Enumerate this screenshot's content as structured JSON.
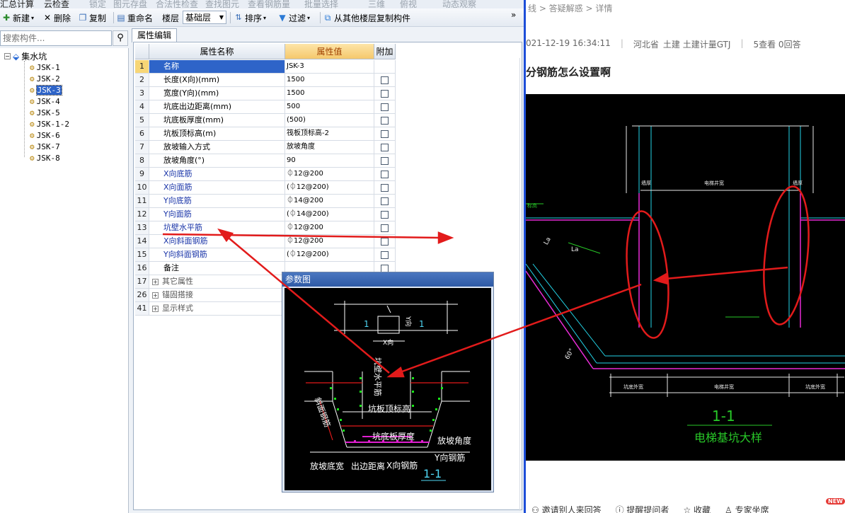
{
  "menubar": {
    "items": [
      "汇总计算",
      "云检查",
      "锁定",
      "图元存盘",
      "合法性检查",
      "查找图元",
      "查看钢筋量",
      "批量选择",
      "三维",
      "俯视",
      "动态观察"
    ]
  },
  "toolbar": {
    "new_label": "新建",
    "delete_label": "删除",
    "copy_label": "复制",
    "rename_label": "重命名",
    "floor_label": "楼层",
    "floor_value": "基础层",
    "sort_label": "排序",
    "filter_label": "过滤",
    "copy_from_floor_label": "从其他楼层复制构件",
    "more_icon": "»"
  },
  "search": {
    "placeholder": "搜索构件..."
  },
  "tree": {
    "root_label": "集水坑",
    "items": [
      "JSK-1",
      "JSK-2",
      "JSK-3",
      "JSK-4",
      "JSK-5",
      "JSK-1-2",
      "JSK-6",
      "JSK-7",
      "JSK-8"
    ],
    "selected": "JSK-3"
  },
  "properties": {
    "tab_label": "属性编辑",
    "headers": {
      "name": "属性名称",
      "value": "属性值",
      "extra": "附加"
    },
    "rows": [
      {
        "num": "1",
        "name": "名称",
        "value": "JSK-3"
      },
      {
        "num": "2",
        "name": "长度(X向)(mm)",
        "value": "1500"
      },
      {
        "num": "3",
        "name": "宽度(Y向)(mm)",
        "value": "1500"
      },
      {
        "num": "4",
        "name": "坑底出边距离(mm)",
        "value": "500"
      },
      {
        "num": "5",
        "name": "坑底板厚度(mm)",
        "value": "(500)"
      },
      {
        "num": "6",
        "name": "坑板顶标高(m)",
        "value": "筏板顶标高-2"
      },
      {
        "num": "7",
        "name": "放坡输入方式",
        "value": "放坡角度"
      },
      {
        "num": "8",
        "name": "放坡角度(°)",
        "value": "90"
      },
      {
        "num": "9",
        "name": "X向底筋",
        "value": "⏀12@200"
      },
      {
        "num": "10",
        "name": "X向面筋",
        "value": "(⏀12@200)"
      },
      {
        "num": "11",
        "name": "Y向底筋",
        "value": "⏀14@200"
      },
      {
        "num": "12",
        "name": "Y向面筋",
        "value": "(⏀14@200)"
      },
      {
        "num": "13",
        "name": "坑壁水平筋",
        "value": "⏀12@200"
      },
      {
        "num": "14",
        "name": "X向斜面钢筋",
        "value": "⏀12@200"
      },
      {
        "num": "15",
        "name": "Y向斜面钢筋",
        "value": "(⏀12@200)"
      },
      {
        "num": "16",
        "name": "备注",
        "value": ""
      },
      {
        "num": "17",
        "name": "其它属性",
        "value": ""
      },
      {
        "num": "26",
        "name": "锚固搭接",
        "value": ""
      },
      {
        "num": "41",
        "name": "显示样式",
        "value": ""
      }
    ]
  },
  "dialog": {
    "title": "参数图",
    "labels": {
      "x_dir": "X向",
      "y_dir": "Y向",
      "one": "1",
      "wall_bar": "坑壁水平筋",
      "top_elev": "坑板顶标高",
      "bottom_thick": "坑底板厚度",
      "slope_angle": "放坡角度",
      "y_bar": "Y向钢筋",
      "x_bar": "X向钢筋",
      "slope_width": "放坡底宽",
      "edge_dist": "出边距离",
      "slope_bar": "斜面钢筋",
      "section": "1-1"
    }
  },
  "web": {
    "breadcrumb": "线 > 答疑解惑 > 详情",
    "date": "021-12-19 16:34:11",
    "location": "河北省",
    "tags": "土建 土建计量GTJ",
    "stats": "5查看 0回答",
    "title": "分钢筋怎么设置啊",
    "cad_labels": {
      "section": "1-1",
      "caption": "电梯基坑大样",
      "la1": "La",
      "la2": "La",
      "angle": "60°",
      "dim1": "坑底外宽",
      "dim2": "电梯井宽",
      "dim3": "坑底外宽",
      "top_dim": "电梯井宽",
      "left_wall": "墙厚",
      "right_wall": "墙厚"
    },
    "actions": [
      "邀请别人来回答",
      "提醒提问者",
      "收藏",
      "专家坐席"
    ],
    "new_badge": "NEW"
  },
  "colors": {
    "selection": "#2e64c8",
    "annotation_red": "#e21b1b",
    "cad_bg": "#000000"
  }
}
